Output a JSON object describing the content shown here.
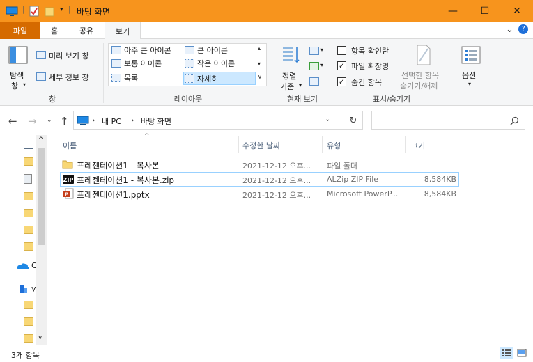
{
  "window": {
    "title": "바탕 화면",
    "minimize_glyph": "—",
    "maximize_glyph": "☐",
    "close_glyph": "✕"
  },
  "tabs": {
    "file": "파일",
    "home": "홈",
    "share": "공유",
    "view": "보기",
    "help_glyph": "?",
    "collapse_glyph": "⌄"
  },
  "ribbon": {
    "pane": {
      "nav_pane_line1": "탐색",
      "nav_pane_line2": "창",
      "preview": "미리 보기 창",
      "details": "세부 정보 창",
      "group": "창"
    },
    "layout": {
      "extra_large": "아주 큰 아이콘",
      "large": "큰 아이콘",
      "medium": "보통 아이콘",
      "small": "작은 아이콘",
      "list": "목록",
      "details": "자세히",
      "group": "레이아웃"
    },
    "current_view": {
      "sort_line1": "정렬",
      "sort_line2": "기준",
      "group": "현재 보기"
    },
    "show_hide": {
      "item_checkboxes": "항목 확인란",
      "item_checkboxes_checked": false,
      "file_extensions": "파일 확장명",
      "file_extensions_checked": true,
      "hidden_items": "숨긴 항목",
      "hidden_items_checked": true,
      "hide_selected_line1": "선택한 항목",
      "hide_selected_line2": "숨기기/해제",
      "group": "표시/숨기기"
    },
    "options": {
      "label": "옵션"
    }
  },
  "address": {
    "path": [
      "내 PC",
      "바탕 화면"
    ],
    "separator": "›",
    "search_placeholder": ""
  },
  "columns": {
    "name": "이름",
    "modified": "수정한 날짜",
    "type": "유형",
    "size": "크기"
  },
  "files": [
    {
      "name": "프레젠테이션1 - 복사본",
      "modified": "2021-12-12 오후...",
      "type": "파일 폴더",
      "size": "",
      "icon": "folder-icon"
    },
    {
      "name": "프레젠테이션1 - 복사본.zip",
      "modified": "2021-12-12 오후...",
      "type": "ALZip ZIP File",
      "size": "8,584KB",
      "icon": "zip-icon"
    },
    {
      "name": "프레젠테이션1.pptx",
      "modified": "2021-12-12 오후...",
      "type": "Microsoft PowerP...",
      "size": "8,584KB",
      "icon": "pptx-icon"
    }
  ],
  "navpane": {
    "onedrive_letter": "C",
    "network_letter": "y"
  },
  "status": {
    "count": "3개 항목"
  },
  "colors": {
    "titlebar": "#f7941d",
    "file_tab": "#d56a00",
    "selection_border": "#99d1ff",
    "selection_fill": "#cce8ff"
  }
}
